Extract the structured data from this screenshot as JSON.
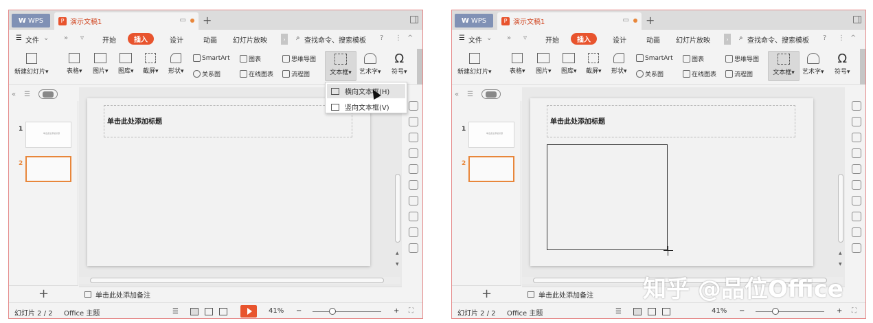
{
  "app": {
    "brand_tab": "WPS",
    "doc_tab": "演示文稿1",
    "new_tab_plus": "+"
  },
  "menu": {
    "file": "文件",
    "more": "»",
    "dropdown_arrow": "▿",
    "tabs": [
      "开始",
      "插入",
      "设计",
      "动画",
      "幻灯片放映"
    ],
    "active_tab": "插入",
    "search": "查找命令、搜索模板",
    "help": "?",
    "options": "⋮",
    "collapse": "^"
  },
  "ribbon": {
    "new_slide": "新建幻灯片",
    "table": "表格",
    "picture": "图片",
    "gallery": "图库",
    "screenshot": "截屏",
    "shape": "形状",
    "smartart": "SmartArt",
    "chart": "图表",
    "relation": "关系图",
    "online_chart": "在线图表",
    "mindmap": "思维导图",
    "flowchart": "流程图",
    "textbox": "文本框",
    "wordart": "艺术字",
    "symbol": "符号",
    "symbol_glyph": "Ω"
  },
  "dropdown": {
    "items": [
      "横向文本框(H)",
      "竖向文本框(V)"
    ]
  },
  "slides_panel": {
    "collapse": "«",
    "slides": [
      {
        "number": "1",
        "thumb_text": "单击此处添加标题"
      },
      {
        "number": "2",
        "thumb_text": ""
      }
    ],
    "add": "+"
  },
  "editor": {
    "title_placeholder": "单击此处添加标题",
    "notes_placeholder": "单击此处添加备注"
  },
  "status": {
    "slide_counter": "幻灯片 2 / 2",
    "theme": "Office 主题",
    "zoom": "41%",
    "zoom_minus": "−",
    "zoom_plus": "+"
  },
  "watermark": "知乎 @品位Office",
  "colors": {
    "accent": "#e8542e",
    "wps_tab": "#8091b5",
    "frame": "#e58a8a"
  }
}
